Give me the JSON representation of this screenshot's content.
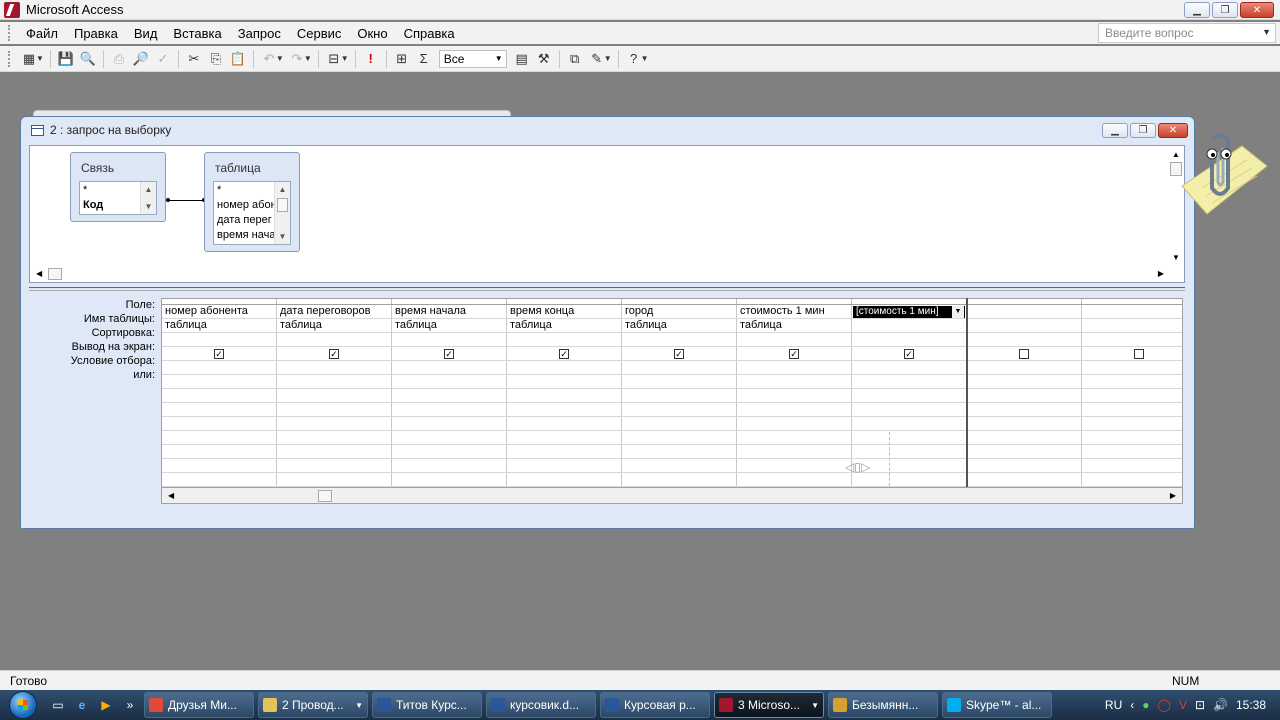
{
  "app": {
    "title": "Microsoft Access",
    "menus": [
      "Файл",
      "Правка",
      "Вид",
      "Вставка",
      "Запрос",
      "Сервис",
      "Окно",
      "Справка"
    ],
    "question_placeholder": "Введите вопрос"
  },
  "toolbar": {
    "top_values_combo": "Все"
  },
  "query_window": {
    "title": "2 : запрос на выборку",
    "tables": [
      {
        "name": "Связь",
        "fields": [
          "*",
          "Код"
        ]
      },
      {
        "name": "таблица",
        "fields": [
          "*",
          "номер абон",
          "дата перег",
          "время нача"
        ]
      }
    ],
    "row_labels": [
      "Поле:",
      "Имя таблицы:",
      "Сортировка:",
      "Вывод на экран:",
      "Условие отбора:",
      "или:"
    ],
    "columns": [
      {
        "field": "номер абонента",
        "table": "таблица",
        "show": true
      },
      {
        "field": "дата переговоров",
        "table": "таблица",
        "show": true
      },
      {
        "field": "время начала",
        "table": "таблица",
        "show": true
      },
      {
        "field": "время конца",
        "table": "таблица",
        "show": true
      },
      {
        "field": "город",
        "table": "таблица",
        "show": true
      },
      {
        "field": "стоимость 1 мин",
        "table": "таблица",
        "show": true
      },
      {
        "field": "[стоимость 1 мин]",
        "table": "",
        "show": true,
        "selected": true
      },
      {
        "field": "",
        "table": "",
        "show": false
      },
      {
        "field": "",
        "table": "",
        "show": false
      }
    ]
  },
  "status": {
    "left": "Готово",
    "num": "NUM"
  },
  "taskbar": {
    "tasks": [
      {
        "label": "Друзья Ми...",
        "color": "#e04a3a",
        "has_dropdown": false,
        "active": false
      },
      {
        "label": "2 Провод...",
        "color": "#e6c35a",
        "has_dropdown": true,
        "active": false
      },
      {
        "label": "Титов Курс...",
        "color": "#2b579a",
        "has_dropdown": false,
        "active": false
      },
      {
        "label": "курсовик.d...",
        "color": "#2b579a",
        "has_dropdown": false,
        "active": false
      },
      {
        "label": "Курсовая р...",
        "color": "#2b579a",
        "has_dropdown": false,
        "active": false
      },
      {
        "label": "3 Microso...",
        "color": "#a2162e",
        "has_dropdown": true,
        "active": true
      },
      {
        "label": "Безымянн...",
        "color": "#d8a030",
        "has_dropdown": false,
        "active": false
      },
      {
        "label": "Skype™ - al...",
        "color": "#00aff0",
        "has_dropdown": false,
        "active": false
      }
    ],
    "language": "RU",
    "clock": "15:38"
  }
}
